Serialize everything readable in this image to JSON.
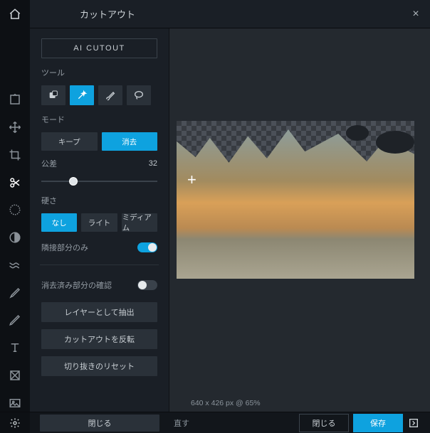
{
  "title": "カットアウト",
  "close": "×",
  "ai_cutout": "AI CUTOUT",
  "labels": {
    "tool": "ツール",
    "mode": "モード",
    "tolerance": "公差",
    "hardness": "硬さ",
    "contiguous": "隣接部分のみ",
    "confirm_erased": "消去済み部分の確認"
  },
  "mode": {
    "keep": "キープ",
    "remove": "消去"
  },
  "tolerance_value": "32",
  "hardness": {
    "none": "なし",
    "light": "ライト",
    "medium": "ミディアム"
  },
  "actions": {
    "extract_layer": "レイヤーとして抽出",
    "invert_cutout": "カットアウトを反転",
    "reset_crop": "切り抜きのリセット",
    "close": "閉じる",
    "redo_suffix": "直す",
    "save": "保存"
  },
  "canvas": {
    "dimensions": "640 x 426 px @ 65%"
  },
  "toggles": {
    "contiguous": true,
    "confirm_erased": false
  }
}
